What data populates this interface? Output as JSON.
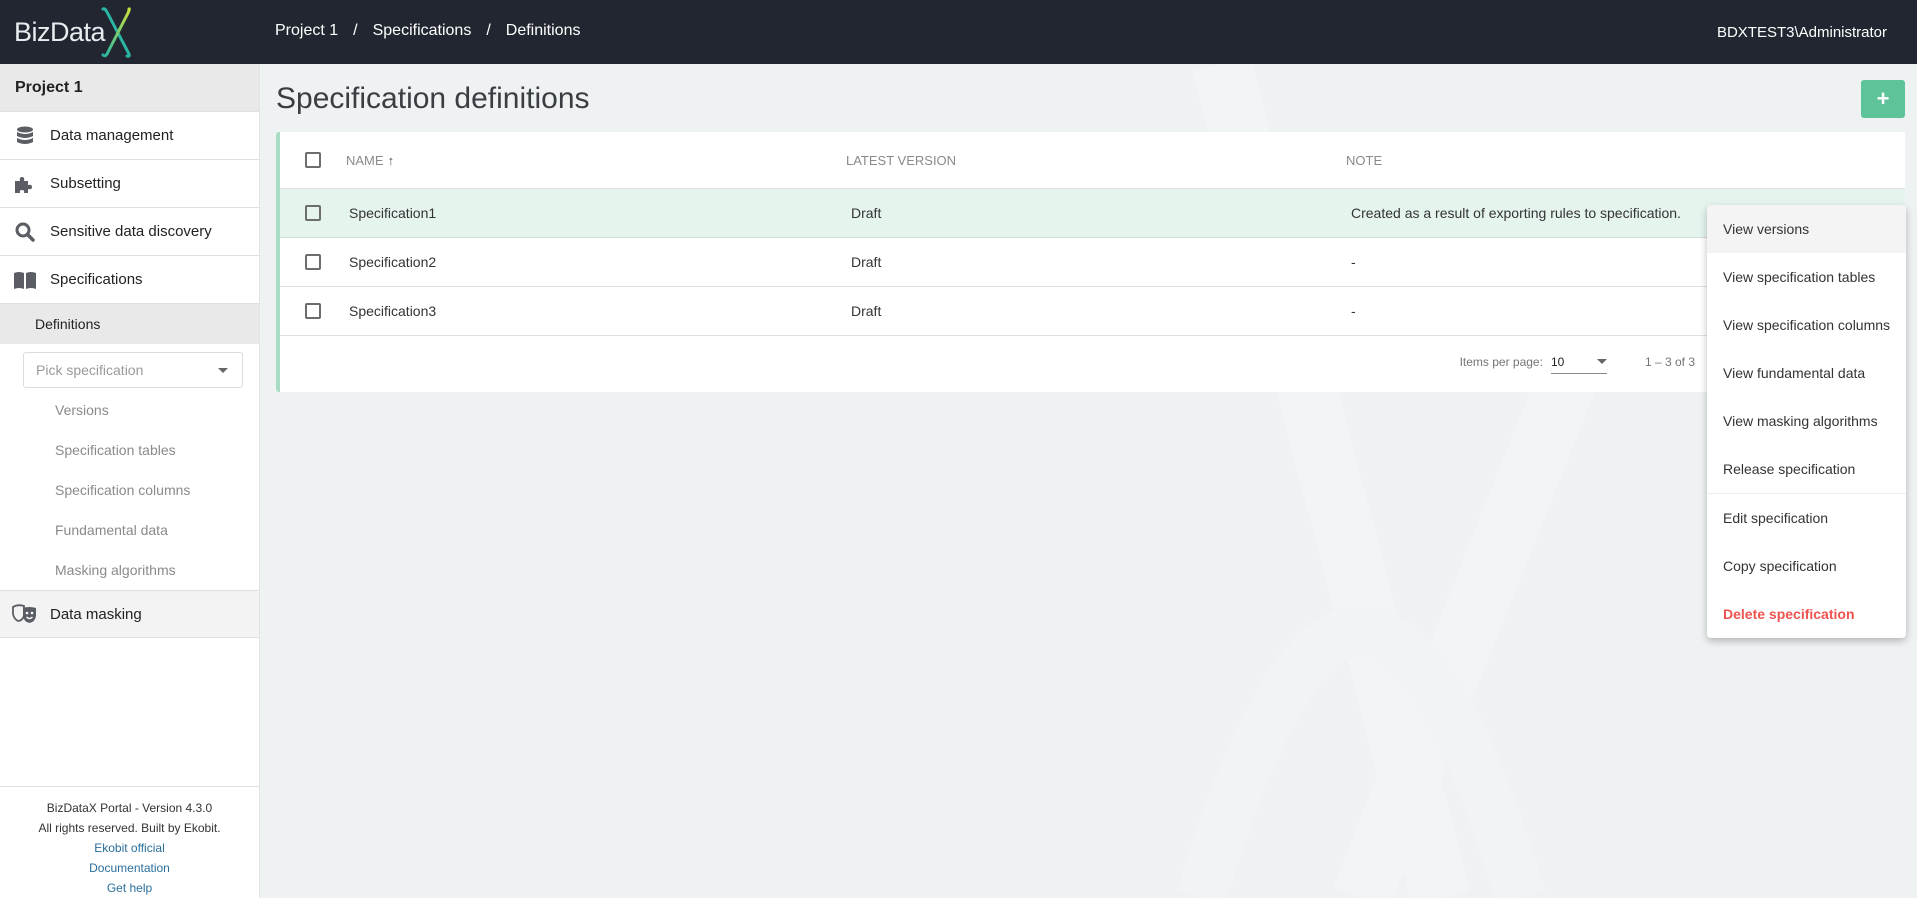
{
  "app": {
    "logo_text": "BizData",
    "logo_mark": "X",
    "user": "BDXTEST3\\Administrator"
  },
  "breadcrumb": [
    "Project 1",
    "Specifications",
    "Definitions"
  ],
  "breadcrumb_separator": "/",
  "sidebar": {
    "project": "Project 1",
    "items": [
      {
        "label": "Data management",
        "icon": "database-icon"
      },
      {
        "label": "Subsetting",
        "icon": "puzzle-icon"
      },
      {
        "label": "Sensitive data discovery",
        "icon": "search-icon"
      },
      {
        "label": "Specifications",
        "icon": "book-icon"
      }
    ],
    "active_sub": "Definitions",
    "picker_placeholder": "Pick specification",
    "sub_items": [
      "Versions",
      "Specification tables",
      "Specification columns",
      "Fundamental data",
      "Masking algorithms"
    ],
    "masking": {
      "label": "Data masking",
      "icon": "theater-masks-icon"
    },
    "footer": {
      "version": "BizDataX Portal - Version 4.3.0",
      "rights": "All rights reserved. Built by Ekobit.",
      "links": [
        "Ekobit official",
        "Documentation",
        "Get help"
      ]
    }
  },
  "page": {
    "title": "Specification definitions",
    "add_button": "+"
  },
  "table": {
    "columns": [
      "NAME",
      "LATEST VERSION",
      "NOTE"
    ],
    "sort_indicator": "↑",
    "rows": [
      {
        "name": "Specification1",
        "version": "Draft",
        "note": "Created as a result of exporting rules to specification.",
        "selected": true
      },
      {
        "name": "Specification2",
        "version": "Draft",
        "note": "-",
        "selected": false
      },
      {
        "name": "Specification3",
        "version": "Draft",
        "note": "-",
        "selected": false
      }
    ]
  },
  "paginator": {
    "items_per_page_label": "Items per page:",
    "items_per_page": "10",
    "range": "1 – 3 of 3"
  },
  "context_menu": {
    "items": [
      {
        "label": "View versions",
        "hover": true
      },
      {
        "label": "View specification tables"
      },
      {
        "label": "View specification columns"
      },
      {
        "label": "View fundamental data"
      },
      {
        "label": "View masking algorithms"
      },
      {
        "label": "Release specification"
      },
      {
        "label": "Edit specification"
      },
      {
        "label": "Copy specification"
      },
      {
        "label": "Delete specification",
        "danger": true
      }
    ]
  },
  "colors": {
    "header_bg": "#212630",
    "accent_green": "#5fc399",
    "selected_row": "#e5f5ee",
    "danger": "#ef5350",
    "link": "#2a6f9b"
  }
}
